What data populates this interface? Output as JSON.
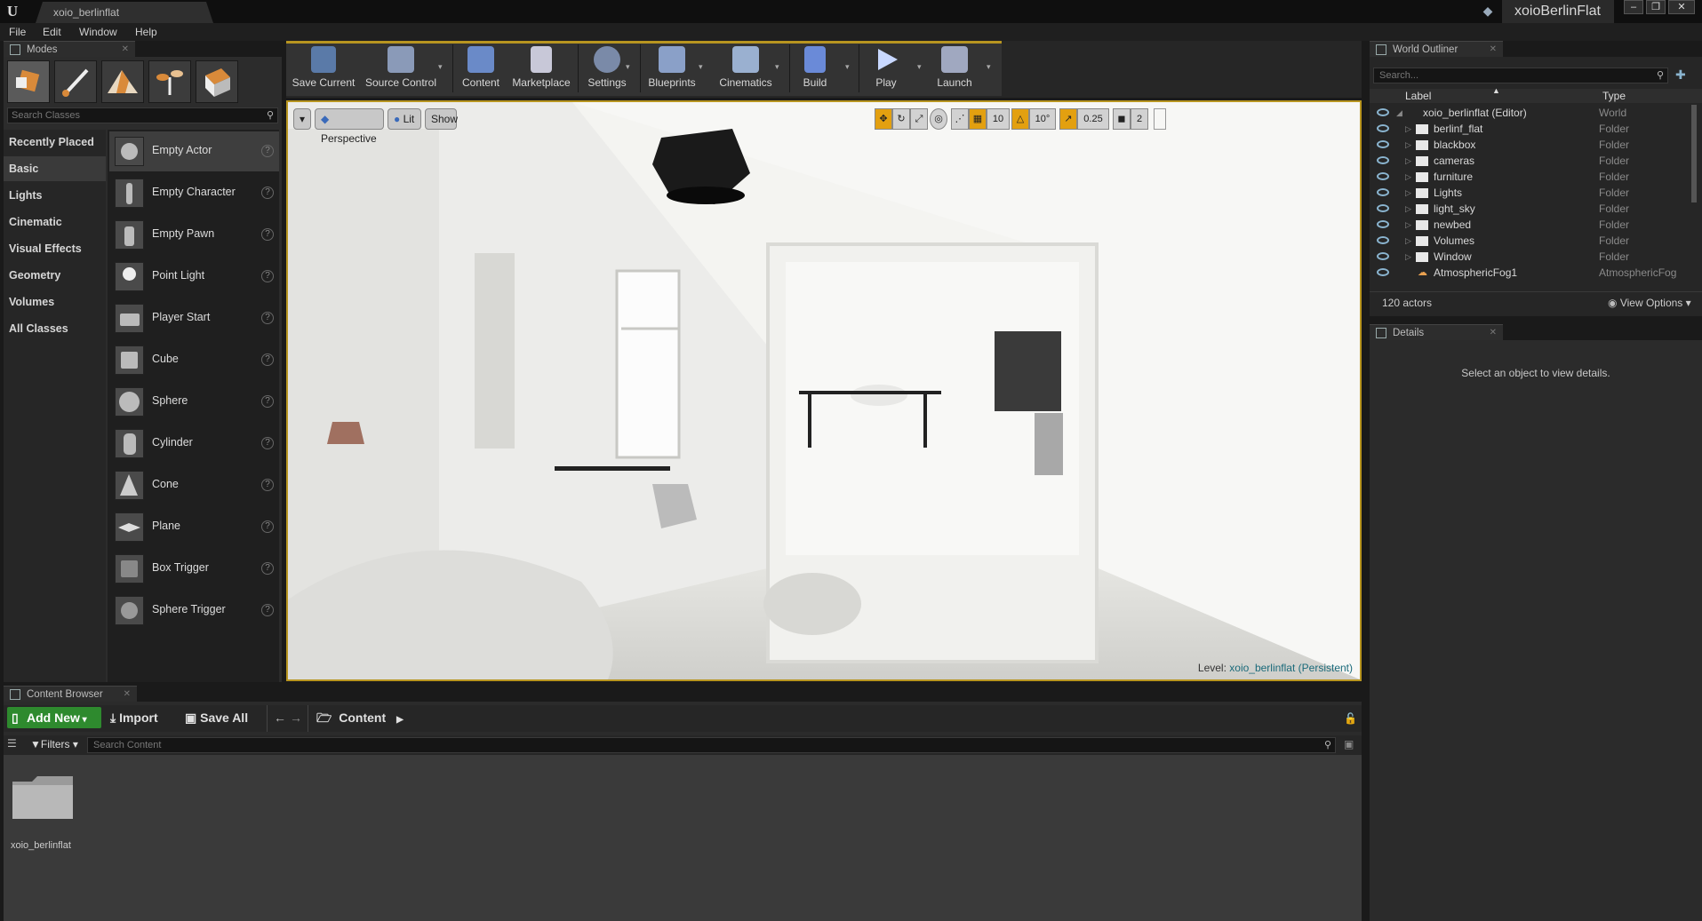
{
  "titlebar": {
    "doc_tab": "xoio_berlinflat",
    "project_name": "xoioBerlinFlat",
    "window_buttons": [
      "–",
      "❐",
      "✕"
    ]
  },
  "menu": [
    "File",
    "Edit",
    "Window",
    "Help"
  ],
  "modes": {
    "tab_label": "Modes",
    "search_placeholder": "Search Classes",
    "categories": [
      "Recently Placed",
      "Basic",
      "Lights",
      "Cinematic",
      "Visual Effects",
      "Geometry",
      "Volumes",
      "All Classes"
    ],
    "active_category": "Basic",
    "items": [
      "Empty Actor",
      "Empty Character",
      "Empty Pawn",
      "Point Light",
      "Player Start",
      "Cube",
      "Sphere",
      "Cylinder",
      "Cone",
      "Plane",
      "Box Trigger",
      "Sphere Trigger"
    ],
    "help_glyph": "?"
  },
  "toolbar": {
    "buttons": [
      "Save Current",
      "Source Control",
      "Content",
      "Marketplace",
      "Settings",
      "Blueprints",
      "Cinematics",
      "Build",
      "Play",
      "Launch"
    ],
    "dropdown_glyph": "▾"
  },
  "viewport": {
    "menu_glyph": "▾",
    "perspective": "Perspective",
    "lit": "Lit",
    "show": "Show",
    "grid_snap": "10",
    "rotation_snap": "10°",
    "scale_snap": "0.25",
    "camera_speed": "2",
    "level_prefix": "Level:",
    "level_name": "xoio_berlinflat (Persistent)"
  },
  "outliner": {
    "tab_label": "World Outliner",
    "search_placeholder": "Search...",
    "col_label": "Label",
    "col_type": "Type",
    "rows": [
      {
        "label": "xoio_berlinflat (Editor)",
        "type": "World"
      },
      {
        "label": "berlinf_flat",
        "type": "Folder"
      },
      {
        "label": "blackbox",
        "type": "Folder"
      },
      {
        "label": "cameras",
        "type": "Folder"
      },
      {
        "label": "furniture",
        "type": "Folder"
      },
      {
        "label": "Lights",
        "type": "Folder"
      },
      {
        "label": "light_sky",
        "type": "Folder"
      },
      {
        "label": "newbed",
        "type": "Folder"
      },
      {
        "label": "Volumes",
        "type": "Folder"
      },
      {
        "label": "Window",
        "type": "Folder"
      },
      {
        "label": "AtmosphericFog1",
        "type": "AtmosphericFog"
      }
    ],
    "actors_count": "120 actors",
    "view_options": "View Options"
  },
  "details": {
    "tab_label": "Details",
    "empty_message": "Select an object to view details."
  },
  "content_browser": {
    "tab_label": "Content Browser",
    "add_new": "Add New",
    "import": "Import",
    "save_all": "Save All",
    "path": "Content",
    "filters": "Filters",
    "search_placeholder": "Search Content",
    "folders": [
      "xoio_berlinflat"
    ]
  },
  "colors": {
    "accent_gold": "#b89520",
    "add_new_green": "#2e8a2e",
    "eye_blue": "#8ab4cf"
  }
}
